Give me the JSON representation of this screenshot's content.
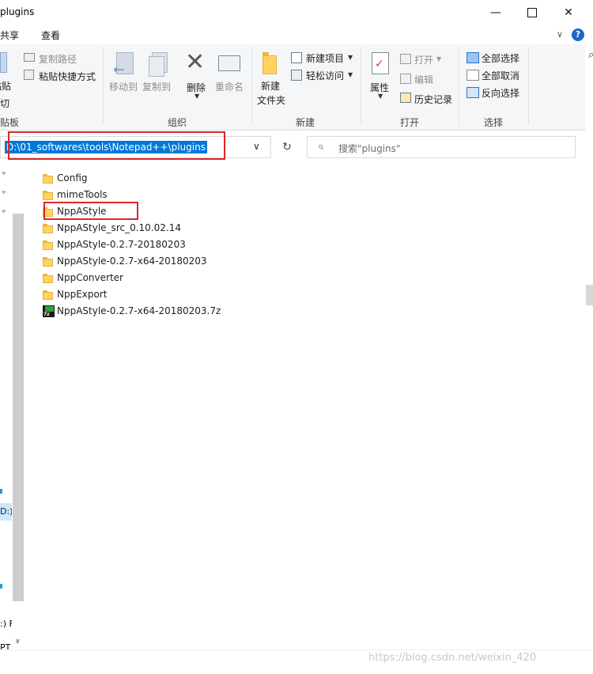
{
  "window": {
    "title": "plugins",
    "min_icon": "minimize-icon",
    "max_icon": "maximize-icon",
    "close_icon": "close-icon"
  },
  "ribbon_tabs": [
    "共享",
    "查看"
  ],
  "ribbon": {
    "clipboard": {
      "paste": "粘贴",
      "cut": "剪切",
      "copy_path": "复制路径",
      "paste_shortcut": "粘贴快捷方式",
      "group": "剪贴板"
    },
    "organize": {
      "move_to": "移动到",
      "copy_to": "复制到",
      "delete": "删除",
      "rename": "重命名",
      "group": "组织"
    },
    "new": {
      "new_folder_line1": "新建",
      "new_folder_line2": "文件夹",
      "new_item": "新建项目",
      "easy_access": "轻松访问",
      "group": "新建"
    },
    "open": {
      "properties": "属性",
      "open": "打开",
      "edit": "编辑",
      "history": "历史记录",
      "group": "打开"
    },
    "select": {
      "select_all": "全部选择",
      "select_none": "全部取消",
      "invert": "反向选择",
      "group": "选择"
    }
  },
  "address": {
    "path": "D:\\01_softwares\\tools\\Notepad++\\plugins"
  },
  "search": {
    "placeholder": "搜索\"plugins\""
  },
  "nav": {
    "drive": "D:)",
    "item1": ":) F",
    "item2": "PT"
  },
  "files": [
    {
      "name": "Config",
      "type": "folder"
    },
    {
      "name": "mimeTools",
      "type": "folder"
    },
    {
      "name": "NppAStyle",
      "type": "folder"
    },
    {
      "name": "NppAStyle_src_0.10.02.14",
      "type": "folder"
    },
    {
      "name": "NppAStyle-0.2.7-20180203",
      "type": "folder"
    },
    {
      "name": "NppAStyle-0.2.7-x64-20180203",
      "type": "folder"
    },
    {
      "name": "NppConverter",
      "type": "folder"
    },
    {
      "name": "NppExport",
      "type": "folder"
    },
    {
      "name": "NppAStyle-0.2.7-x64-20180203.7z",
      "type": "7z-archive"
    }
  ],
  "watermark": "https://blog.csdn.net/weixin_420"
}
